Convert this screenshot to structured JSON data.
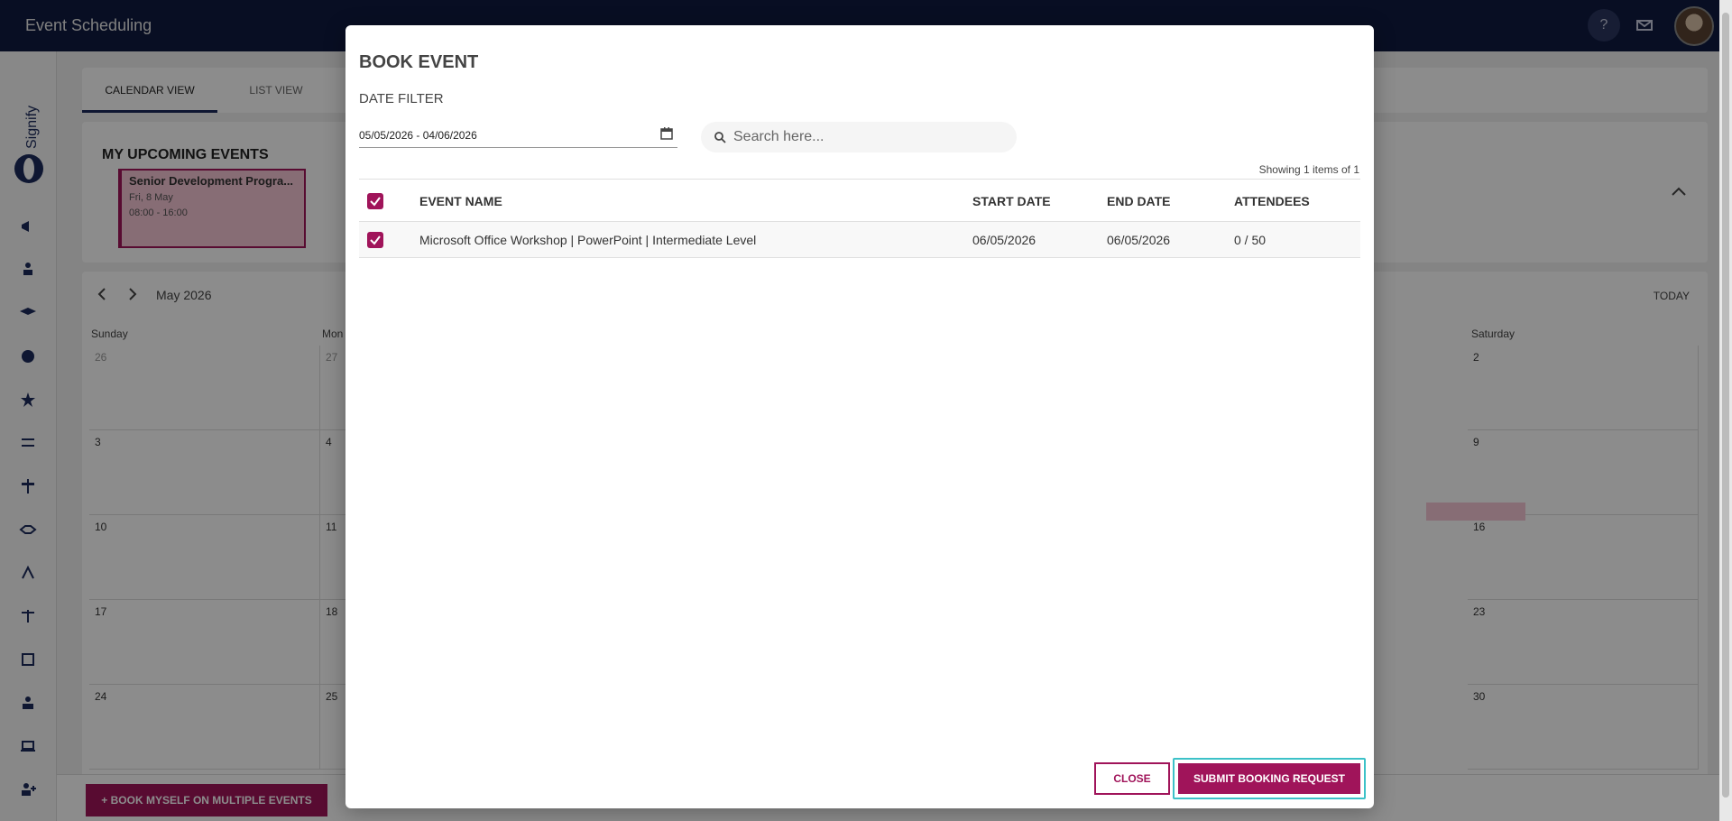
{
  "app": {
    "title": "Event Scheduling"
  },
  "topbar": {
    "help_label": "?"
  },
  "tabs": [
    {
      "label": "CALENDAR VIEW"
    },
    {
      "label": "LIST VIEW"
    }
  ],
  "upcoming": {
    "title": "MY UPCOMING EVENTS",
    "event": {
      "name": "Senior Development Progra...",
      "date": "Fri, 8 May",
      "time": "08:00 - 16:00"
    }
  },
  "calendar": {
    "month_label": "May 2026",
    "today_label": "TODAY",
    "day_labels": [
      "Sunday",
      "Mon",
      "Saturday"
    ],
    "weeks": [
      [
        "26",
        "27",
        "2"
      ],
      [
        "3",
        "4",
        "9"
      ],
      [
        "10",
        "11",
        "16"
      ],
      [
        "17",
        "18",
        "23"
      ],
      [
        "24",
        "25",
        "30"
      ]
    ]
  },
  "bottom": {
    "book_multi_label": "+ BOOK MYSELF ON MULTIPLE EVENTS"
  },
  "modal": {
    "title": "BOOK EVENT",
    "filter_label": "DATE FILTER",
    "date_range": "05/05/2026 - 04/06/2026",
    "search_placeholder": "Search here...",
    "showing": "Showing 1 items of 1",
    "columns": [
      "EVENT NAME",
      "START DATE",
      "END DATE",
      "ATTENDEES"
    ],
    "rows": [
      {
        "name": "Microsoft Office Workshop | PowerPoint | Intermediate Level",
        "start": "06/05/2026",
        "end": "06/05/2026",
        "attendees": "0 / 50"
      }
    ],
    "close_label": "CLOSE",
    "submit_label": "SUBMIT BOOKING REQUEST"
  },
  "colors": {
    "brand": "#a0145a",
    "topbar": "#0f1a40",
    "focus": "#3cc1c8"
  }
}
